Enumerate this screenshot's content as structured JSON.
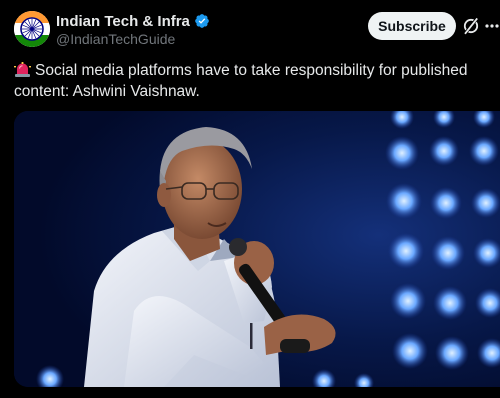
{
  "post": {
    "author": {
      "display_name": "Indian Tech & Infra",
      "handle": "@IndianTechGuide",
      "verified": true,
      "avatar_icon": "indian-flag-chakra-avatar"
    },
    "subscribe_label": "Subscribe",
    "text_emoji": "rotating-light-siren-icon",
    "text": "Social media platforms have to take responsibility for published content: Ashwini Vaishnaw.",
    "colors": {
      "background": "#000000",
      "primary_text": "#e7e9ea",
      "secondary_text": "#71767b",
      "verified_blue": "#1d9bf0",
      "button_bg": "#eff3f4"
    }
  }
}
